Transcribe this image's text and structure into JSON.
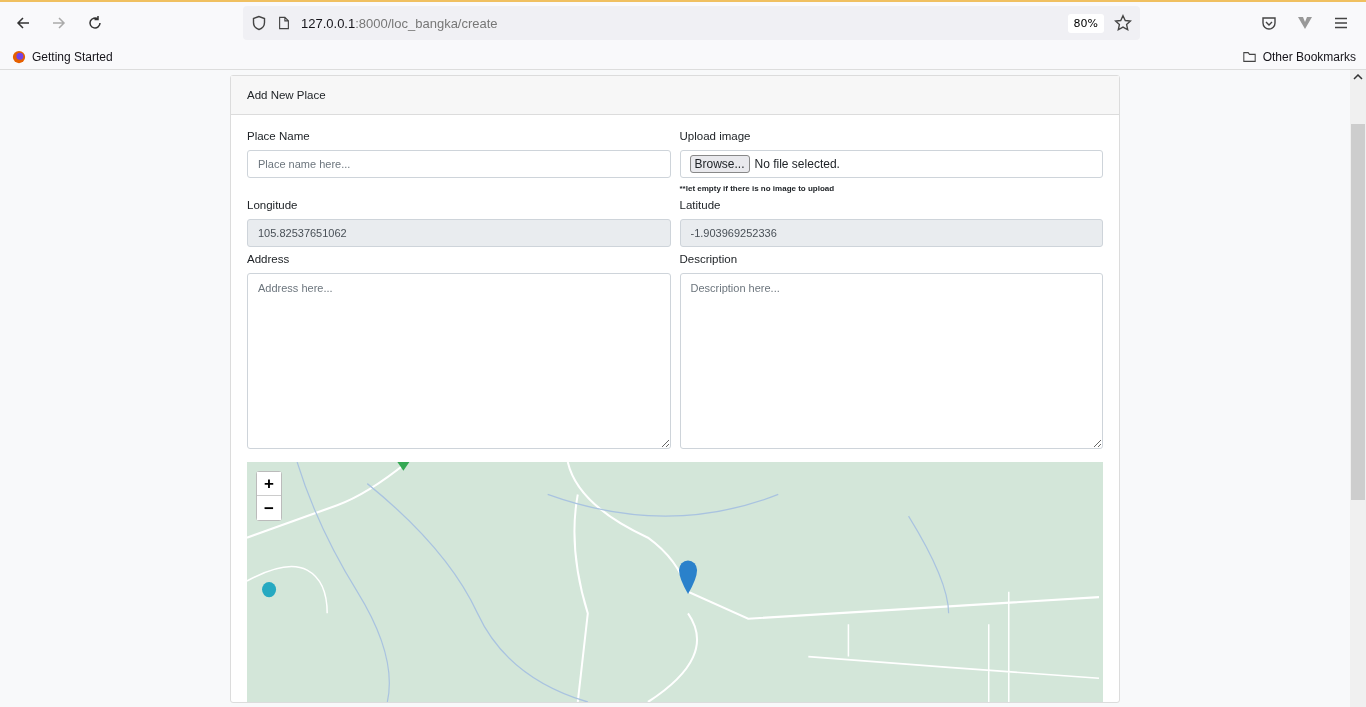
{
  "browser": {
    "url_host": "127.0.0.1",
    "url_path": ":8000/loc_bangka/create",
    "zoom": "80%",
    "bookmarks": [
      "Getting Started"
    ],
    "other_bookmarks": "Other Bookmarks"
  },
  "card": {
    "title": "Add New Place",
    "fields": [
      {
        "kind": "text",
        "label": "Place Name",
        "placeholder": "Place name here..."
      },
      {
        "kind": "file",
        "label": "Upload image",
        "button": "Browse...",
        "status": "No file selected.",
        "note": "**let empty if there is no image to upload"
      },
      {
        "kind": "readonly",
        "label": "Longitude",
        "value": "105.82537651062"
      },
      {
        "kind": "readonly",
        "label": "Latitude",
        "value": "-1.903969252336"
      },
      {
        "kind": "textarea",
        "label": "Address",
        "placeholder": "Address here..."
      },
      {
        "kind": "textarea",
        "label": "Description",
        "placeholder": "Description here..."
      }
    ],
    "map": {
      "kind": "picture",
      "zoom_in": "+",
      "zoom_out": "−"
    }
  }
}
